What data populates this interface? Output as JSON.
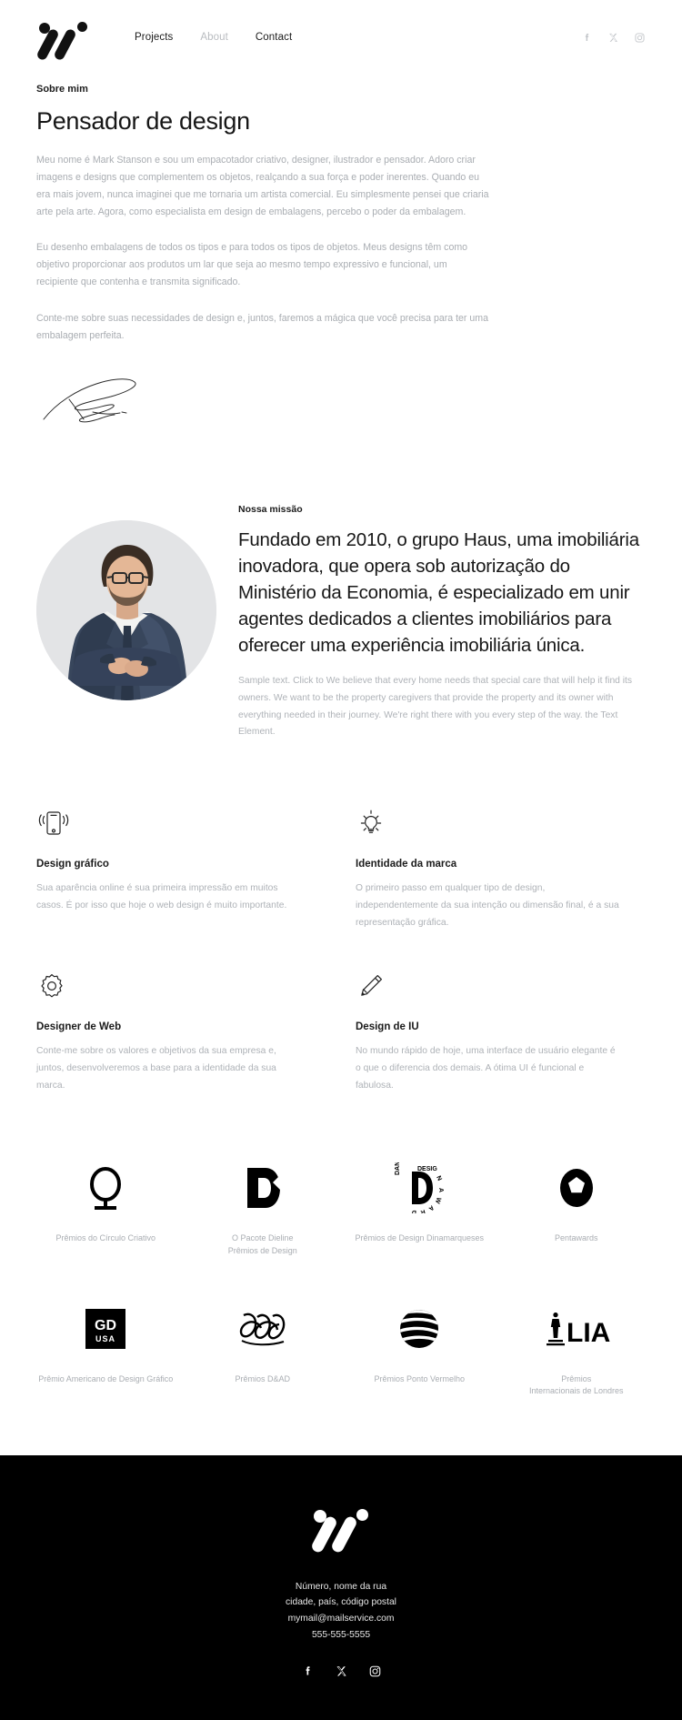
{
  "header": {
    "logo_name": "w-logo",
    "nav": [
      {
        "label": "Projects",
        "state": "default"
      },
      {
        "label": "About",
        "state": "muted"
      },
      {
        "label": "Contact",
        "state": "default"
      }
    ],
    "social": [
      {
        "name": "facebook-icon"
      },
      {
        "name": "x-twitter-icon"
      },
      {
        "name": "instagram-icon"
      }
    ]
  },
  "about": {
    "eyebrow": "Sobre mim",
    "title": "Pensador de design",
    "paragraphs": [
      "Meu nome é Mark Stanson e sou um empacotador criativo, designer, ilustrador e pensador. Adoro criar imagens e designs que complementem os objetos, realçando a sua força e poder inerentes. Quando eu era mais jovem, nunca imaginei que me tornaria um artista comercial. Eu simplesmente pensei que criaria arte pela arte. Agora, como especialista em design de embalagens, percebo o poder da embalagem.",
      "Eu desenho embalagens de todos os tipos e para todos os tipos de objetos. Meus designs têm como objetivo proporcionar aos produtos um lar que seja ao mesmo tempo expressivo e funcional, um recipiente que contenha e transmita significado.",
      "Conte-me sobre suas necessidades de design e, juntos, faremos a mágica que você precisa para ter uma embalagem perfeita."
    ],
    "signature_name": "handwritten-signature"
  },
  "mission": {
    "portrait_name": "portrait-photo",
    "eyebrow": "Nossa missão",
    "heading": "Fundado em 2010, o grupo Haus, uma imobiliária inovadora, que opera sob autorização do Ministério da Economia, é especializado em unir agentes dedicados a clientes imobiliários para oferecer uma experiência imobiliária única.",
    "paragraph": "Sample text. Click to We believe that every home needs that special care that will help it find its owners. We want to be the property caregivers that provide the property and its owner with everything needed in their journey. We're right there with you every step of the way. the Text Element."
  },
  "services": [
    {
      "icon": "vibrating-phone-icon",
      "title": "Design gráfico",
      "desc": "Sua aparência online é sua primeira impressão em muitos casos. É por isso que hoje o web design é muito importante."
    },
    {
      "icon": "lightbulb-idea-icon",
      "title": "Identidade da marca",
      "desc": "O primeiro passo em qualquer tipo de design, independentemente da sua intenção ou dimensão final, é a sua representação gráfica."
    },
    {
      "icon": "gear-settings-icon",
      "title": "Designer de Web",
      "desc": "Conte-me sobre os valores e objetivos da sua empresa e, juntos, desenvolveremos a base para a identidade da sua marca."
    },
    {
      "icon": "pencil-icon",
      "title": "Design de IU",
      "desc": "No mundo rápido de hoje, uma interface de usuário elegante é o que o diferencia dos demais. A ótima UI é funcional e fabulosa."
    }
  ],
  "awards": [
    {
      "mark": "creative-circle-award-icon",
      "label": "Prêmios do Círculo Criativo"
    },
    {
      "mark": "dieline-package-award-icon",
      "label": "O Pacote Dieline\nPrêmios de Design"
    },
    {
      "mark": "danish-design-award-icon",
      "label": "Prêmios de Design Dinamarqueses"
    },
    {
      "mark": "pentawards-icon",
      "label": "Pentawards"
    },
    {
      "mark": "gd-usa-award-icon",
      "label": "Prêmio Americano de Design Gráfico"
    },
    {
      "mark": "dad-award-icon",
      "label": "Prêmios D&AD"
    },
    {
      "mark": "red-dot-award-icon",
      "label": "Prêmios Ponto Vermelho"
    },
    {
      "mark": "lia-award-icon",
      "label": "Prêmios\nInternacionais de Londres"
    }
  ],
  "footer": {
    "logo_name": "w-logo-footer",
    "address": [
      "Número, nome da rua",
      "cidade, país, código postal",
      "mymail@mailservice.com",
      "555-555-5555"
    ],
    "social": [
      {
        "name": "facebook-icon"
      },
      {
        "name": "x-twitter-icon"
      },
      {
        "name": "instagram-icon"
      }
    ]
  },
  "colors": {
    "background": "#ffffff",
    "text_dark": "#171717",
    "text_muted": "#aeb2b7",
    "nav_muted": "#b9bcc0",
    "footer_bg": "#000000",
    "portrait_bg": "#e3e4e6"
  }
}
